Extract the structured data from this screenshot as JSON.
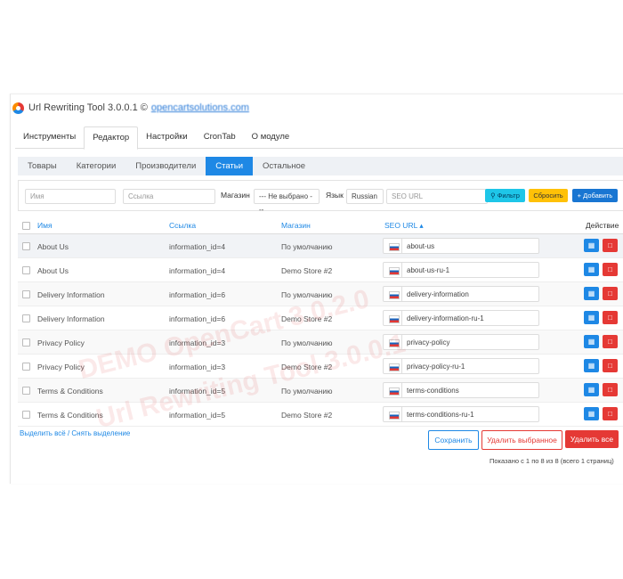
{
  "header": {
    "title": "Url Rewriting Tool 3.0.0.1 ©",
    "link": "opencartsolutions.com"
  },
  "main_tabs": [
    "Инструменты",
    "Редактор",
    "Настройки",
    "CronTab",
    "О модуле"
  ],
  "sub_tabs": [
    "Товары",
    "Категории",
    "Производители",
    "Статьи",
    "Остальное"
  ],
  "filter": {
    "name_placeholder": "Имя",
    "link_placeholder": "Ссылка",
    "store_label": "Магазин",
    "store_value": "--- Не выбрано ---",
    "lang_label": "Язык",
    "lang_value": "Russian",
    "seo_placeholder": "SEO URL",
    "filter_button": "Фильтр",
    "reset_button": "Сбросить",
    "add_button": "Добавить"
  },
  "table": {
    "headers": {
      "name": "Имя",
      "link": "Ссылка",
      "store": "Магазин",
      "seo": "SEO URL ▴",
      "action": "Действие"
    },
    "rows": [
      {
        "name": "About Us",
        "link": "information_id=4",
        "store": "По умолчанию",
        "seo": "about-us"
      },
      {
        "name": "About Us",
        "link": "information_id=4",
        "store": "Demo Store #2",
        "seo": "about-us-ru-1"
      },
      {
        "name": "Delivery Information",
        "link": "information_id=6",
        "store": "По умолчанию",
        "seo": "delivery-information"
      },
      {
        "name": "Delivery Information",
        "link": "information_id=6",
        "store": "Demo Store #2",
        "seo": "delivery-information-ru-1"
      },
      {
        "name": "Privacy Policy",
        "link": "information_id=3",
        "store": "По умолчанию",
        "seo": "privacy-policy"
      },
      {
        "name": "Privacy Policy",
        "link": "information_id=3",
        "store": "Demo Store #2",
        "seo": "privacy-policy-ru-1"
      },
      {
        "name": "Terms & Conditions",
        "link": "information_id=5",
        "store": "По умолчанию",
        "seo": "terms-conditions"
      },
      {
        "name": "Terms & Conditions",
        "link": "information_id=5",
        "store": "Demo Store #2",
        "seo": "terms-conditions-ru-1"
      }
    ]
  },
  "footer": {
    "select_all": "Выделить всё / Снять выделение",
    "save_button": "Сохранить",
    "delete_selected_button": "Удалить выбранное",
    "delete_all_button": "Удалить все",
    "pagination": "Показано с 1 по 8 из 8 (всего 1 страниц)"
  },
  "watermark": {
    "line1": "DEMO OpenCart 3.0.2.0",
    "line2": "Url Rewriting Tool 3.0.0.1"
  },
  "colors": {
    "primary": "#1e88e5",
    "danger": "#e53935",
    "warning": "#ffc107",
    "info": "#1ec6e8"
  }
}
